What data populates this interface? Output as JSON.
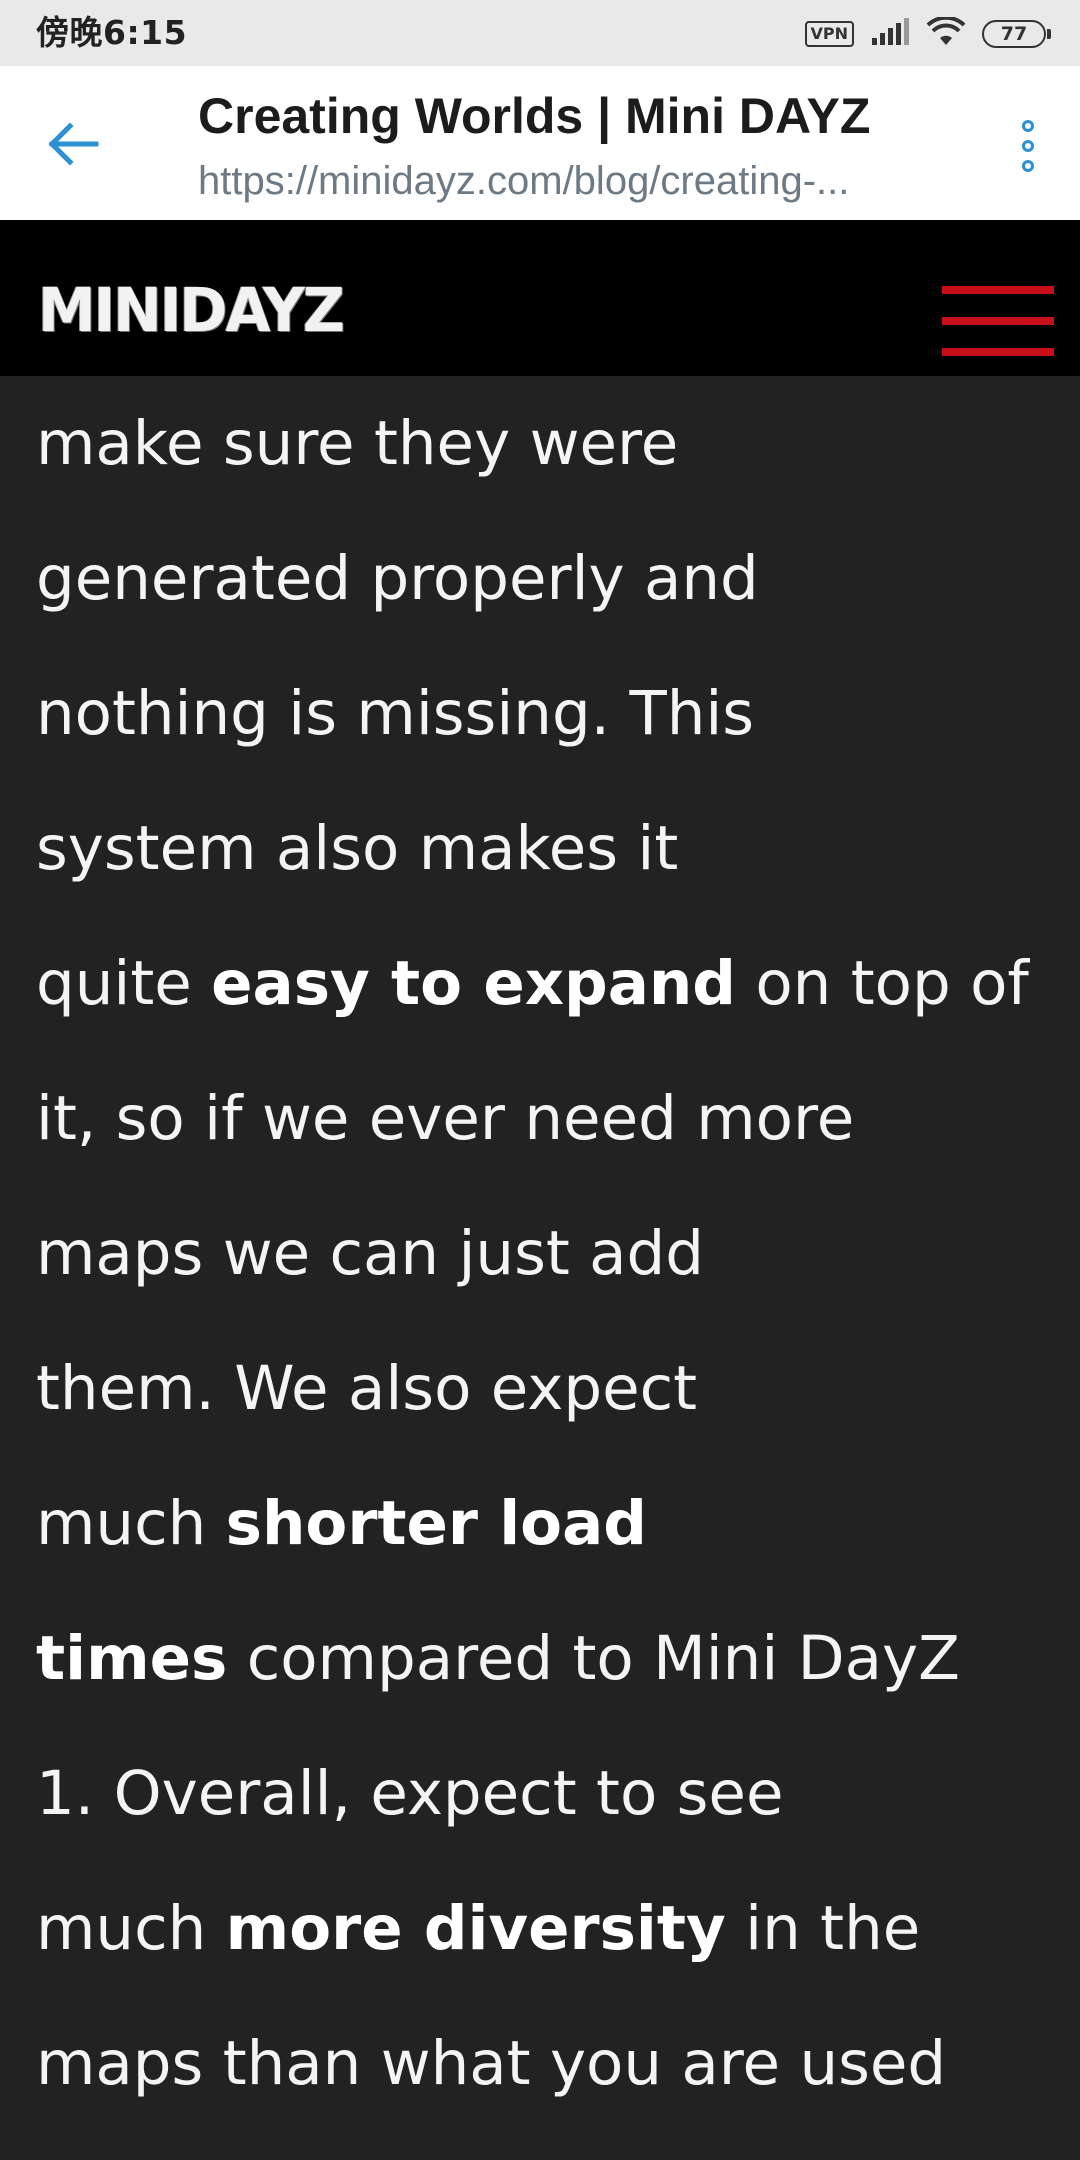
{
  "status_bar": {
    "time": "傍晚6:15",
    "vpn_label": "VPN",
    "battery_level": "77"
  },
  "app_bar": {
    "title": "Creating Worlds | Mini DAYZ",
    "url": "https://minidayz.com/blog/creating-..."
  },
  "site_header": {
    "logo_text": "MINIDAYZ"
  },
  "article": {
    "lines": [
      [
        {
          "text": "make sure they were",
          "bold": false
        }
      ],
      [
        {
          "text": "generated properly and",
          "bold": false
        }
      ],
      [
        {
          "text": "nothing is missing. This",
          "bold": false
        }
      ],
      [
        {
          "text": "system also makes it",
          "bold": false
        }
      ],
      [
        {
          "text": "quite ",
          "bold": false
        },
        {
          "text": "easy to expand",
          "bold": true
        },
        {
          "text": " on top of",
          "bold": false
        }
      ],
      [
        {
          "text": "it, so if we ever need more",
          "bold": false
        }
      ],
      [
        {
          "text": "maps we can just add",
          "bold": false
        }
      ],
      [
        {
          "text": "them. We also expect",
          "bold": false
        }
      ],
      [
        {
          "text": "much ",
          "bold": false
        },
        {
          "text": "shorter load",
          "bold": true
        }
      ],
      [
        {
          "text": "times",
          "bold": true
        },
        {
          "text": " compared to Mini DayZ",
          "bold": false
        }
      ],
      [
        {
          "text": "1. Overall, expect to see",
          "bold": false
        }
      ],
      [
        {
          "text": "much ",
          "bold": false
        },
        {
          "text": "more diversity",
          "bold": true
        },
        {
          "text": " in the",
          "bold": false
        }
      ],
      [
        {
          "text": "maps than what you are used",
          "bold": false
        }
      ]
    ]
  },
  "colors": {
    "accent_blue": "#2d8fd6",
    "menu_red": "#c8101a",
    "page_bg": "#222222",
    "header_bg": "#000000"
  }
}
